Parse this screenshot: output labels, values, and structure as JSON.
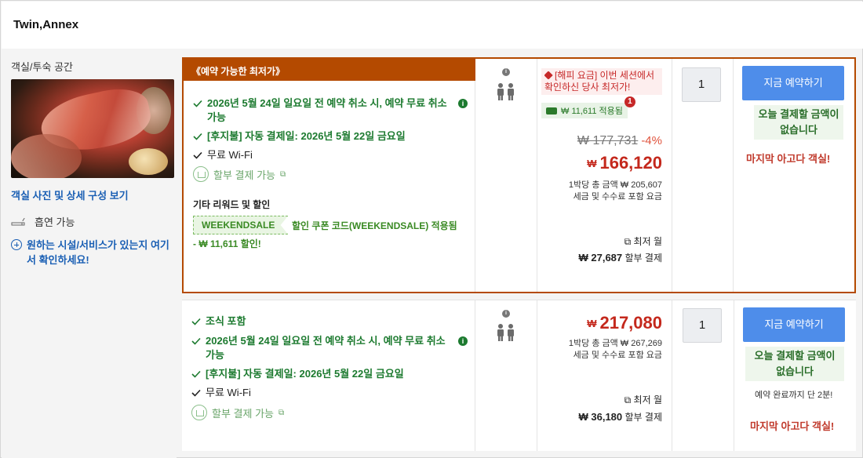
{
  "header": {
    "title": "Twin,Annex"
  },
  "left": {
    "subtitle": "객실/투숙 공간",
    "photos_link": "객실 사진 및 상세 구성 보기",
    "smoking": "흡연 가능",
    "facility_link": "원하는 시설/서비스가 있는지 여기서 확인하세요!"
  },
  "offers": [
    {
      "badge": "《예약 가능한 최저가》",
      "conditions": [
        "2026년 5월 24일 일요일 전 예약 취소 시, 예약 무료 취소 가능",
        "[후지불] 자동 결제일: 2026년 5월 22일 금요일",
        "무료 Wi-Fi"
      ],
      "installment": "할부 결제 가능",
      "other_title": "기타 리워드 및 할인",
      "coupon_code": "WEEKENDSALE",
      "coupon_text": "할인 쿠폰 코드(WEEKENDSALE) 적용됨",
      "coupon_discount": "- ₩ 11,611 할인!",
      "promo": "[해피 요금] 이번 세션에서 확인하신 당사 최저가!",
      "applied": "₩ 11,611 적용됨",
      "applied_count": "1",
      "old_price": "₩ 177,731",
      "discount_pct": "-4%",
      "currency": "₩",
      "price": "166,120",
      "per_night": "1박당 총 금액 ₩ 205,607",
      "tax_note": "세금 및 수수료 포함 요금",
      "monthly_label": "최저 월",
      "monthly_amount": "₩ 27,687",
      "monthly_suffix": "할부 결제",
      "qty": "1",
      "book": "지금 예약하기",
      "nopay": "오늘 결제할 금액이 없습니다",
      "last_room": "마지막 아고다 객실!"
    },
    {
      "conditions": [
        "조식 포함",
        "2026년 5월 24일 일요일 전 예약 취소 시, 예약 무료 취소 가능",
        "[후지불] 자동 결제일: 2026년 5월 22일 금요일",
        "무료 Wi-Fi"
      ],
      "installment": "할부 결제 가능",
      "currency": "₩",
      "price": "217,080",
      "per_night": "1박당 총 금액 ₩ 267,269",
      "tax_note": "세금 및 수수료 포함 요금",
      "monthly_label": "최저 월",
      "monthly_amount": "₩ 36,180",
      "monthly_suffix": "할부 결제",
      "qty": "1",
      "book": "지금 예약하기",
      "nopay": "오늘 결제할 금액이 없습니다",
      "countdown": "예약 완료까지 단 2분!",
      "last_room": "마지막 아고다 객실!"
    }
  ],
  "colors": {
    "accent": "#b44a00",
    "button": "#4e8dea",
    "price": "#c4281c",
    "green": "#1c7a2f"
  }
}
